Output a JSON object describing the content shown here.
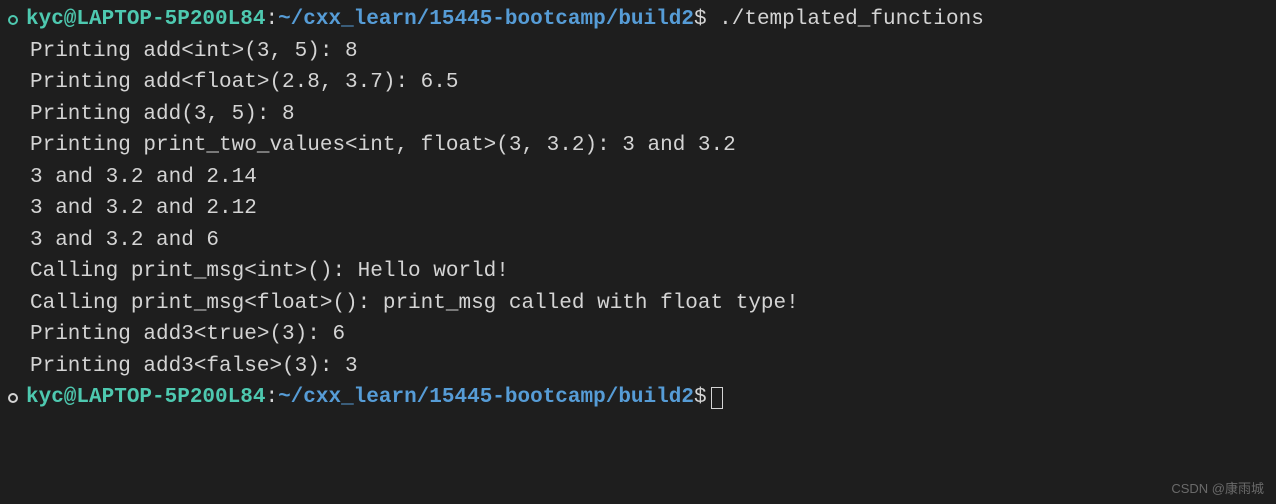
{
  "prompt1": {
    "user_host": "kyc@LAPTOP-5P200L84",
    "colon": ":",
    "path": "~/cxx_learn/15445-bootcamp/build2",
    "dollar": "$",
    "command": " ./templated_functions"
  },
  "output_lines": [
    "Printing add<int>(3, 5): 8",
    "Printing add<float>(2.8, 3.7): 6.5",
    "Printing add(3, 5): 8",
    "Printing print_two_values<int, float>(3, 3.2): 3 and 3.2",
    "3 and 3.2 and 2.14",
    "3 and 3.2 and 2.12",
    "3 and 3.2 and 6",
    "Calling print_msg<int>(): Hello world!",
    "Calling print_msg<float>(): print_msg called with float type!",
    "Printing add3<true>(3): 6",
    "Printing add3<false>(3): 3"
  ],
  "prompt2": {
    "user_host": "kyc@LAPTOP-5P200L84",
    "colon": ":",
    "path": "~/cxx_learn/15445-bootcamp/build2",
    "dollar": "$"
  },
  "watermark": "CSDN @康雨城"
}
